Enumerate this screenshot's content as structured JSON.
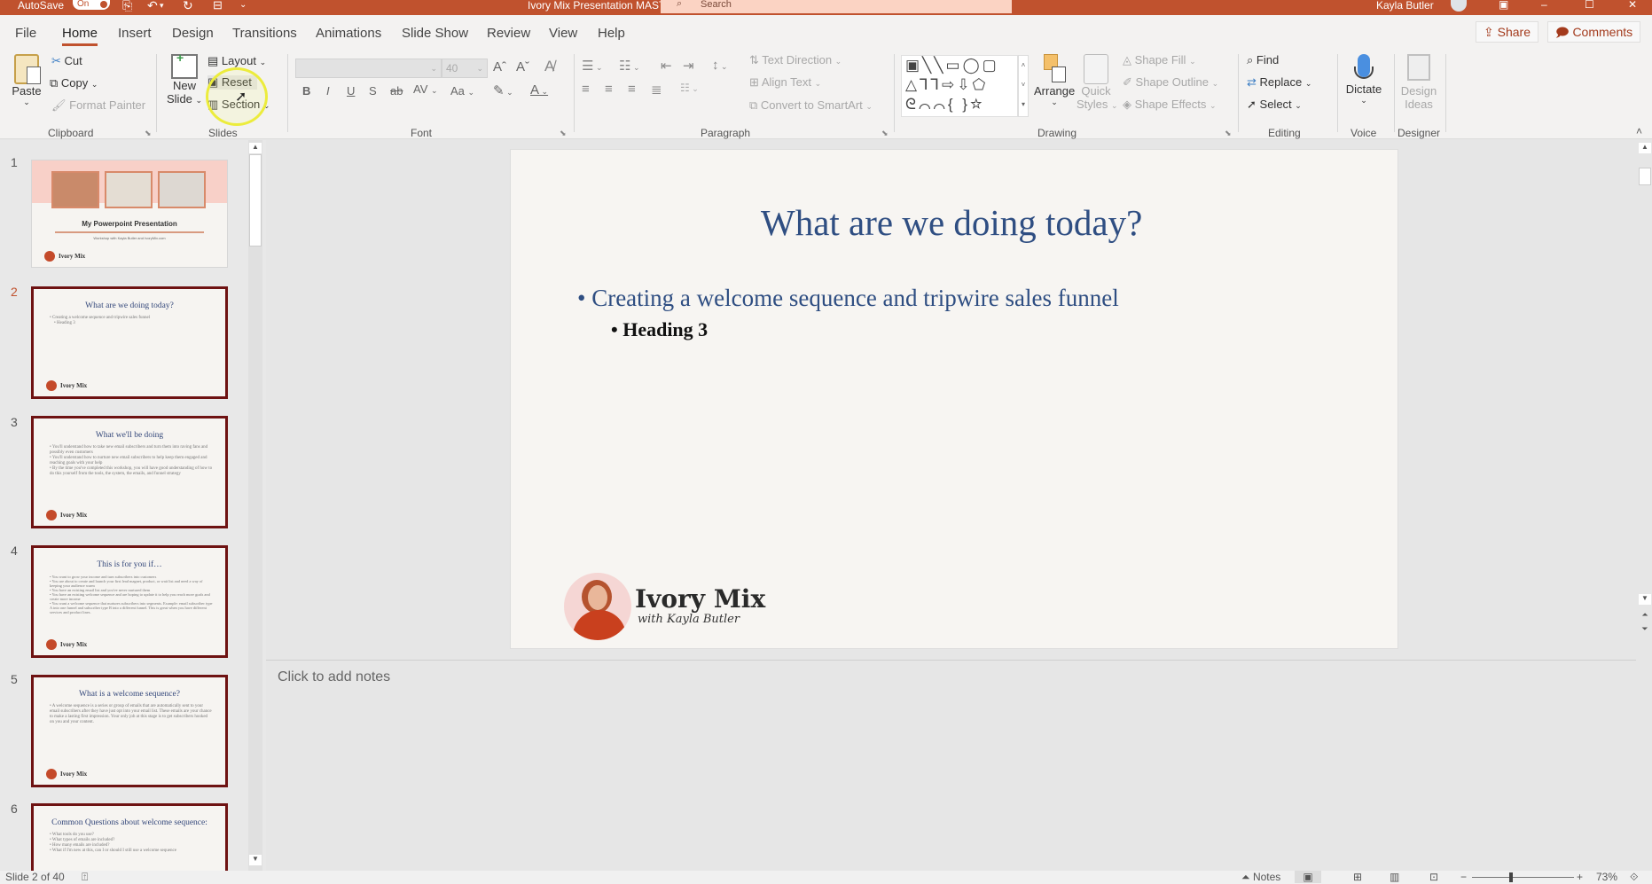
{
  "titlebar": {
    "autosave_label": "AutoSave",
    "autosave_state": "On",
    "doc_title": "Ivory Mix Presentation MASTER  -  Saved",
    "search_placeholder": "Search",
    "user_name": "Kayla Butler"
  },
  "tabs": [
    {
      "label": "File"
    },
    {
      "label": "Home",
      "active": true
    },
    {
      "label": "Insert"
    },
    {
      "label": "Design"
    },
    {
      "label": "Transitions"
    },
    {
      "label": "Animations"
    },
    {
      "label": "Slide Show"
    },
    {
      "label": "Review"
    },
    {
      "label": "View"
    },
    {
      "label": "Help"
    }
  ],
  "top_actions": {
    "share": "Share",
    "comments": "Comments"
  },
  "ribbon": {
    "clipboard": {
      "label": "Clipboard",
      "paste": "Paste",
      "cut": "Cut",
      "copy": "Copy",
      "format_painter": "Format Painter"
    },
    "slides": {
      "label": "Slides",
      "new_slide_line1": "New",
      "new_slide_line2": "Slide",
      "layout": "Layout",
      "reset": "Reset",
      "section": "Section"
    },
    "font": {
      "label": "Font",
      "font_name": "",
      "font_size": "40",
      "bold": "B",
      "italic": "I",
      "underline": "U",
      "shadow": "S",
      "strike": "ab",
      "spacing": "AV",
      "case": "Aa"
    },
    "paragraph": {
      "label": "Paragraph",
      "text_direction": "Text Direction",
      "align_text": "Align Text",
      "convert_smartart": "Convert to SmartArt"
    },
    "drawing": {
      "label": "Drawing",
      "arrange": "Arrange",
      "quick_styles_1": "Quick",
      "quick_styles_2": "Styles",
      "shape_fill": "Shape Fill",
      "shape_outline": "Shape Outline",
      "shape_effects": "Shape Effects",
      "shapes_row1": "▣╲╲▭◯▢",
      "shapes_row2": "△⅂⅂⇨⇩⬠",
      "shapes_row3": "ᘓ⌒⌒{ }☆"
    },
    "editing": {
      "label": "Editing",
      "find": "Find",
      "replace": "Replace",
      "select": "Select"
    },
    "voice": {
      "label": "Voice",
      "dictate": "Dictate"
    },
    "designer": {
      "label": "Designer",
      "design_ideas_1": "Design",
      "design_ideas_2": "Ideas"
    }
  },
  "thumbnails": [
    {
      "num": "1",
      "title": "My Powerpoint Presentation",
      "subtitle": "Workshop with Kayla Butler and IvoryMix.com",
      "logo": "Ivory Mix"
    },
    {
      "num": "2",
      "title": "What are we doing today?",
      "body": "• Creating a welcome sequence and tripwire sales funnel\n    • Heading 3",
      "logo": "Ivory Mix"
    },
    {
      "num": "3",
      "title": "What we'll be doing",
      "body": "• You'll understand how to take new email subscribers and turn them into raving fans and possibly even customers\n• You'll understand how to nurture new email subscribers to help keep them engaged and reaching goals with your help\n• By the time you've completed this workshop, you will have good understanding of how to do this yourself from the tools, the system, the emails, and funnel strategy",
      "logo": "Ivory Mix"
    },
    {
      "num": "4",
      "title": "This is for you if…",
      "body": "• You want to grow your income and turn subscribers into customers\n• You are about to create and launch your first lead magnet, product, or wait list and need a way of keeping your audience warm\n• You have an existing email list and you've never nurtured them\n• You have an existing welcome sequence and are hoping to update it to help you reach more goals and create more income\n• You want a welcome sequence that nurtures subscribers into segments. Example: email subscriber type A into one funnel and subscriber type B into a different funnel. This is great when you have different services and product lines.",
      "logo": "Ivory Mix"
    },
    {
      "num": "5",
      "title": "What is a welcome sequence?",
      "body": "• A welcome sequence is a series or group of emails that are automatically sent to your email subscribers after they have just opt into your email list. These emails are your chance to make a lasting first impression. Your only job at this stage is to get subscribers hooked on you and your content.",
      "logo": "Ivory Mix"
    },
    {
      "num": "6",
      "title": "Common Questions about welcome sequence:",
      "body": "• What tools do you use?\n• What types of emails are included?\n• How many emails are included?\n• What if I'm new at this, can I or should I still use a welcome sequence",
      "logo": ""
    }
  ],
  "slide": {
    "title": "What are we doing today?",
    "bullet1": "• Creating a welcome sequence and tripwire sales funnel",
    "bullet2": "• Heading 3",
    "logo_name": "Ivory Mix",
    "logo_sub": "with Kayla Butler"
  },
  "notes": {
    "placeholder": "Click to add notes"
  },
  "statusbar": {
    "slide_counter": "Slide 2 of 40",
    "notes_label": "Notes",
    "zoom_level": "73%"
  },
  "colors": {
    "accent": "#c0522e",
    "slide_text": "#2f4e82",
    "thumb_selected_border": "#6e1212"
  }
}
